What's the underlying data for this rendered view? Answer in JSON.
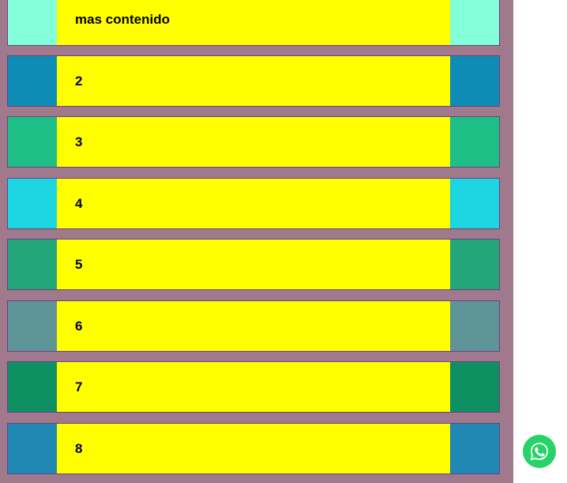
{
  "cards": [
    {
      "label": "mas contenido",
      "side_color": "#82ffd8"
    },
    {
      "label": "2",
      "side_color": "#0f8cb5"
    },
    {
      "label": "3",
      "side_color": "#1ec088"
    },
    {
      "label": "4",
      "side_color": "#1dd6e2"
    },
    {
      "label": "5",
      "side_color": "#24a57a"
    },
    {
      "label": "6",
      "side_color": "#5e9496"
    },
    {
      "label": "7",
      "side_color": "#0e8f62"
    },
    {
      "label": "8",
      "side_color": "#2088b2"
    }
  ],
  "whatsapp": {
    "icon": "whatsapp-icon",
    "color": "#25d366"
  }
}
